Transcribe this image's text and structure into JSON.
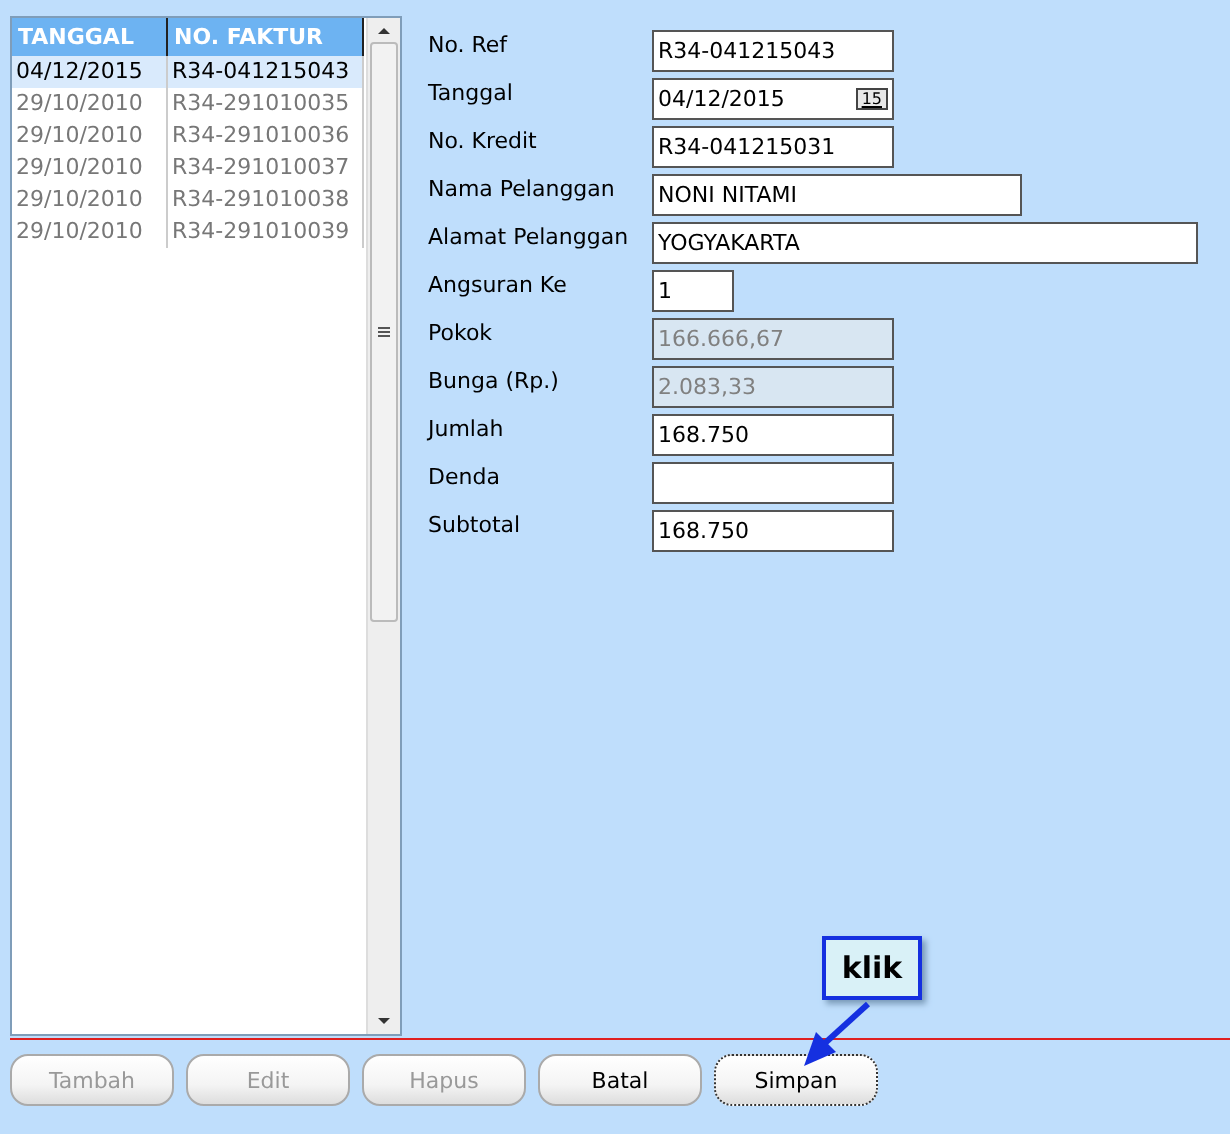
{
  "list": {
    "columns": [
      "TANGGAL",
      "NO. FAKTUR"
    ],
    "rows": [
      {
        "tanggal": "04/12/2015",
        "faktur": "R34-041215043",
        "selected": true
      },
      {
        "tanggal": "29/10/2010",
        "faktur": "R34-291010035",
        "selected": false
      },
      {
        "tanggal": "29/10/2010",
        "faktur": "R34-291010036",
        "selected": false
      },
      {
        "tanggal": "29/10/2010",
        "faktur": "R34-291010037",
        "selected": false
      },
      {
        "tanggal": "29/10/2010",
        "faktur": "R34-291010038",
        "selected": false
      },
      {
        "tanggal": "29/10/2010",
        "faktur": "R34-291010039",
        "selected": false
      }
    ]
  },
  "form": [
    {
      "label": "No. Ref",
      "value": "R34-041215043",
      "disabled": false,
      "kind": "code"
    },
    {
      "label": "Tanggal",
      "value": "04/12/2015",
      "disabled": false,
      "kind": "date",
      "button": "15"
    },
    {
      "label": "No. Kredit",
      "value": "R34-041215031",
      "disabled": false,
      "kind": "code"
    },
    {
      "label": "Nama Pelanggan",
      "value": "NONI NITAMI",
      "disabled": false,
      "kind": "name"
    },
    {
      "label": "Alamat Pelanggan",
      "value": "YOGYAKARTA",
      "disabled": false,
      "kind": "address"
    },
    {
      "label": "Angsuran Ke",
      "value": "1",
      "disabled": false,
      "kind": "count"
    },
    {
      "label": "Pokok",
      "value": "166.666,67",
      "disabled": true,
      "kind": "amount"
    },
    {
      "label": "Bunga (Rp.)",
      "value": "2.083,33",
      "disabled": true,
      "kind": "amount"
    },
    {
      "label": "Jumlah",
      "value": "168.750",
      "disabled": false,
      "kind": "amount"
    },
    {
      "label": "Denda",
      "disabled": false,
      "kind": "amount"
    },
    {
      "label": "Subtotal",
      "value": "168.750",
      "disabled": false,
      "kind": "amount"
    }
  ],
  "buttons": [
    {
      "label": "Tambah",
      "disabled": true,
      "focused": false
    },
    {
      "label": "Edit",
      "disabled": true,
      "focused": false
    },
    {
      "label": "Hapus",
      "disabled": true,
      "focused": false
    },
    {
      "label": "Batal",
      "disabled": false,
      "focused": false
    },
    {
      "label": "Simpan",
      "disabled": false,
      "focused": true
    }
  ],
  "callout": {
    "text": "klik"
  }
}
